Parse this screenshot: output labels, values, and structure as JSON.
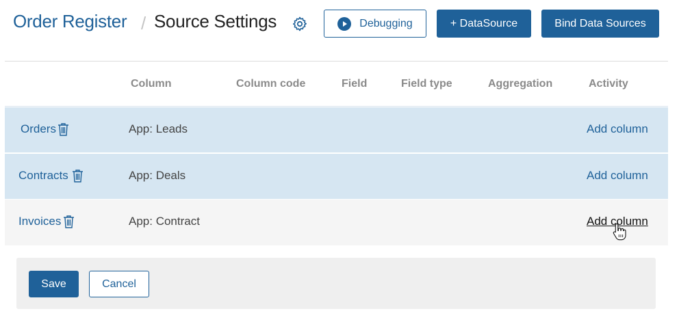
{
  "header": {
    "breadcrumb_link": "Order Register",
    "breadcrumb_separator": "/",
    "title": "Source Settings",
    "settings_icon": "gear-icon",
    "buttons": {
      "debugging": "Debugging",
      "add_data_source": "+ DataSource",
      "bind_data_sources": "Bind Data Sources"
    }
  },
  "table": {
    "columns": [
      "Column",
      "Column code",
      "Field",
      "Field type",
      "Aggregation",
      "Activity"
    ],
    "rows": [
      {
        "source": "Orders",
        "app": "App: Leads",
        "action": "Add column"
      },
      {
        "source": "Contracts",
        "app": "App: Deals",
        "action": "Add column"
      },
      {
        "source": "Invoices",
        "app": "App: Contract",
        "action": "Add column"
      }
    ]
  },
  "footer": {
    "save": "Save",
    "cancel": "Cancel"
  },
  "colors": {
    "accent": "#1f6199",
    "row_highlight": "#d6e6f2",
    "row_plain": "#f5f5f5"
  }
}
